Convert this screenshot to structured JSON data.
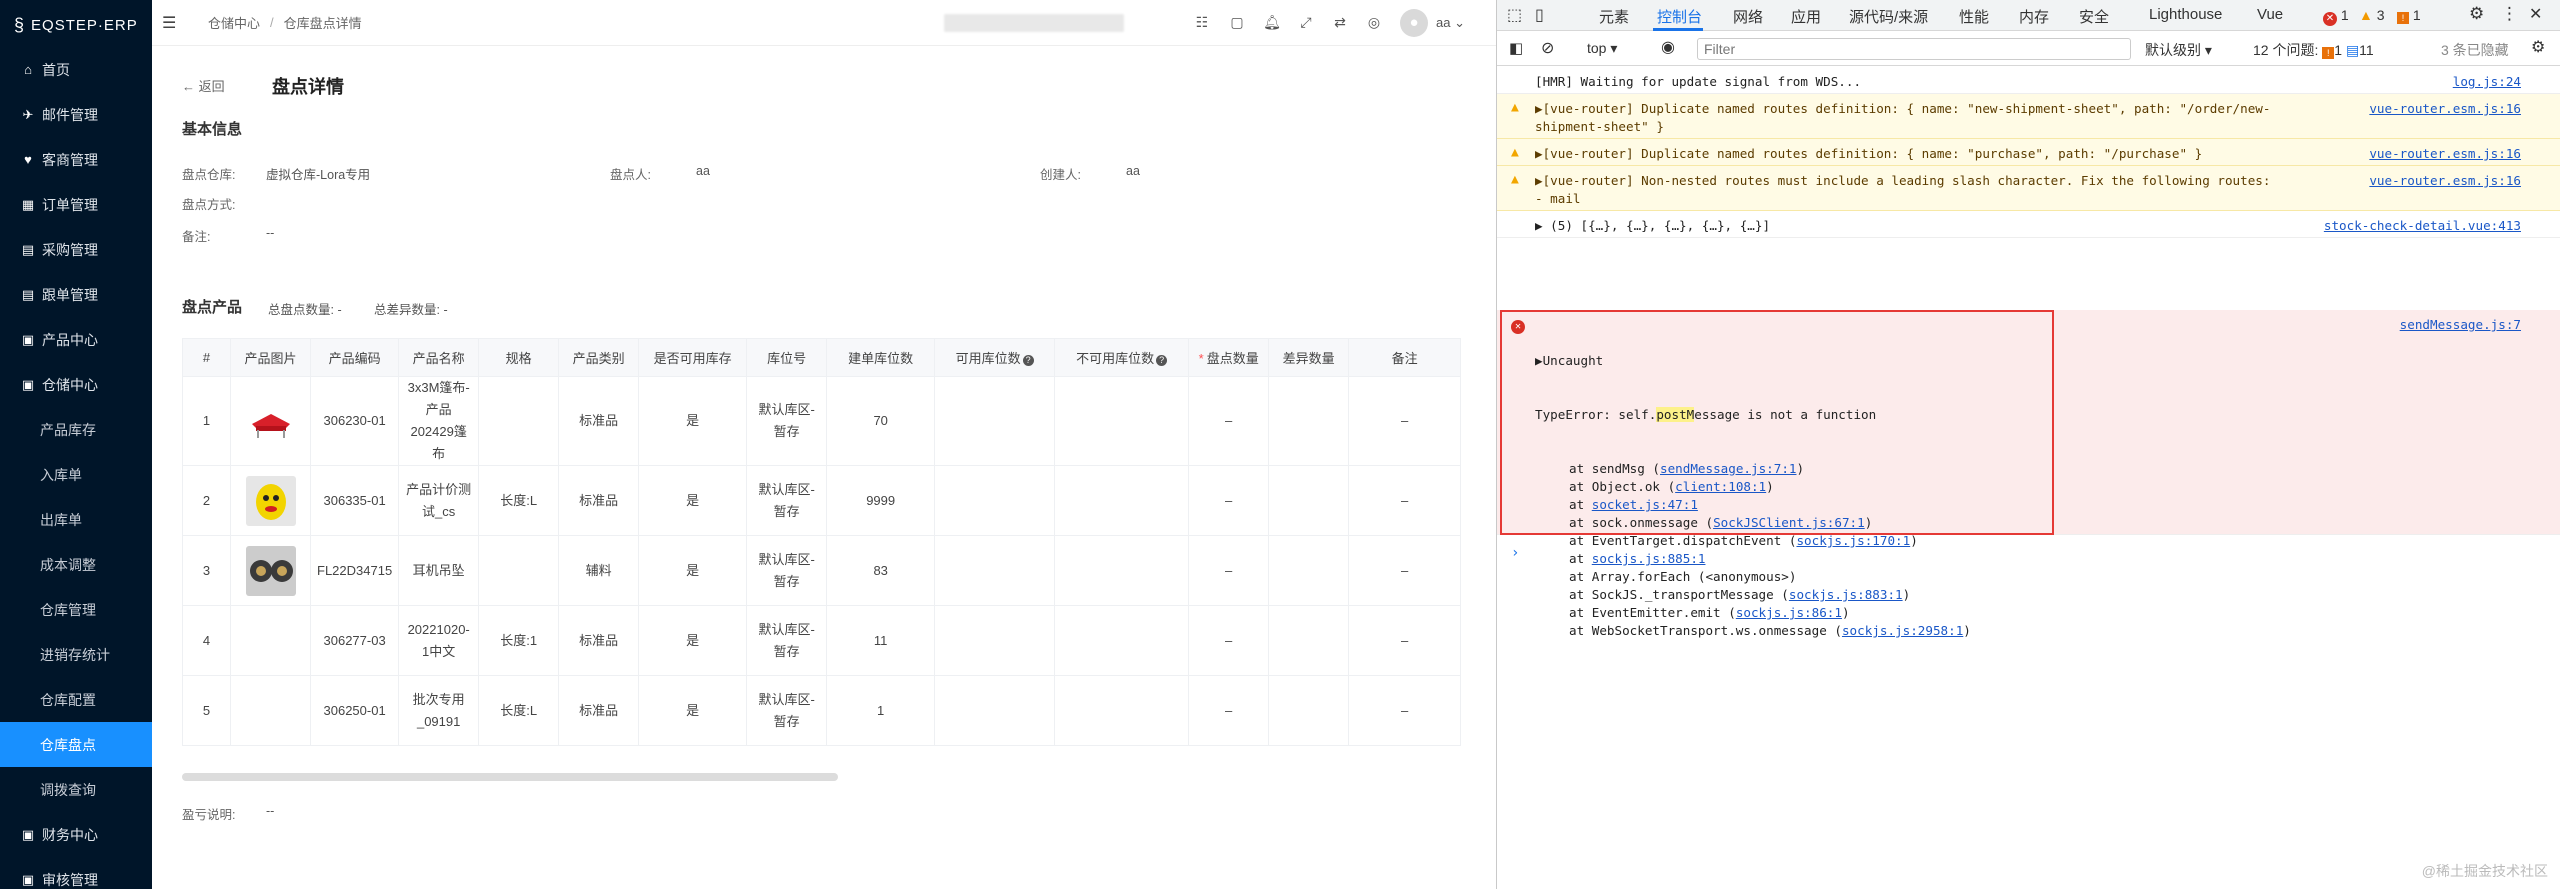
{
  "app": {
    "logo": "EQSTEP·ERP"
  },
  "sidebar": {
    "items": [
      {
        "label": "首页",
        "icon": "home-icon",
        "glyph": "⌂",
        "sub": false,
        "active": false
      },
      {
        "label": "邮件管理",
        "icon": "send-icon",
        "glyph": "✈",
        "sub": false,
        "active": false
      },
      {
        "label": "客商管理",
        "icon": "heart-icon",
        "glyph": "♥",
        "sub": false,
        "active": false
      },
      {
        "label": "订单管理",
        "icon": "grid-icon",
        "glyph": "▦",
        "sub": false,
        "active": false
      },
      {
        "label": "采购管理",
        "icon": "cart-icon",
        "glyph": "▤",
        "sub": false,
        "active": false
      },
      {
        "label": "跟单管理",
        "icon": "track-icon",
        "glyph": "▤",
        "sub": false,
        "active": false
      },
      {
        "label": "产品中心",
        "icon": "box-icon",
        "glyph": "▣",
        "sub": false,
        "active": false
      },
      {
        "label": "仓储中心",
        "icon": "warehouse-icon",
        "glyph": "▣",
        "sub": false,
        "active": false
      },
      {
        "label": "产品库存",
        "sub": true,
        "active": false
      },
      {
        "label": "入库单",
        "sub": true,
        "active": false
      },
      {
        "label": "出库单",
        "sub": true,
        "active": false
      },
      {
        "label": "成本调整",
        "sub": true,
        "active": false
      },
      {
        "label": "仓库管理",
        "sub": true,
        "active": false
      },
      {
        "label": "进销存统计",
        "sub": true,
        "active": false
      },
      {
        "label": "仓库配置",
        "sub": true,
        "active": false
      },
      {
        "label": "仓库盘点",
        "sub": true,
        "active": true
      },
      {
        "label": "调拨查询",
        "sub": true,
        "active": false
      },
      {
        "label": "财务中心",
        "icon": "finance-icon",
        "glyph": "▣",
        "sub": false,
        "active": false
      },
      {
        "label": "审核管理",
        "icon": "audit-icon",
        "glyph": "▣",
        "sub": false,
        "active": false
      }
    ]
  },
  "topbar": {
    "breadcrumb": [
      "仓储中心",
      "仓库盘点详情"
    ],
    "user": "aa"
  },
  "page": {
    "back": "← 返回",
    "title": "盘点详情",
    "basic_title": "基本信息",
    "info": {
      "warehouse_label": "盘点仓库:",
      "warehouse_value": "虚拟仓库-Lora专用",
      "checker_label": "盘点人:",
      "checker_value": "aa",
      "creator_label": "创建人:",
      "creator_value": "aa",
      "method_label": "盘点方式:",
      "method_value": "",
      "remark_label": "备注:",
      "remark_value": "--"
    },
    "products_title": "盘点产品",
    "total_label": "总盘点数量: -",
    "diff_label": "总差异数量: -",
    "loss_label": "盈亏说明:",
    "loss_value": "--"
  },
  "table": {
    "headers": [
      "#",
      "产品图片",
      "产品编码",
      "产品名称",
      "规格",
      "产品类别",
      "是否可用库存",
      "库位号",
      "建单库位数",
      "可用库位数",
      "不可用库位数",
      "盘点数量",
      "差异数量",
      "备注"
    ],
    "rows": [
      {
        "no": "1",
        "img": "tent",
        "code": "306230-01",
        "name": "3x3M篷布-产品202429篷布",
        "spec": "",
        "cat": "标准品",
        "avail": "是",
        "loc": "默认库区-暂存",
        "qty": "70",
        "ok": "",
        "bad": "",
        "count": "–",
        "diff": "",
        "remark": "–"
      },
      {
        "no": "2",
        "img": "ball",
        "code": "306335-01",
        "name": "产品计价测试_cs",
        "spec": "长度:L",
        "cat": "标准品",
        "avail": "是",
        "loc": "默认库区-暂存",
        "qty": "9999",
        "ok": "",
        "bad": "",
        "count": "–",
        "diff": "",
        "remark": "–"
      },
      {
        "no": "3",
        "img": "earring",
        "code": "FL22D34715",
        "name": "耳机吊坠",
        "spec": "",
        "cat": "辅料",
        "avail": "是",
        "loc": "默认库区-暂存",
        "qty": "83",
        "ok": "",
        "bad": "",
        "count": "–",
        "diff": "",
        "remark": "–"
      },
      {
        "no": "4",
        "img": "",
        "code": "306277-03",
        "name": "20221020-1中文",
        "spec": "长度:1",
        "cat": "标准品",
        "avail": "是",
        "loc": "默认库区-暂存",
        "qty": "11",
        "ok": "",
        "bad": "",
        "count": "–",
        "diff": "",
        "remark": "–"
      },
      {
        "no": "5",
        "img": "",
        "code": "306250-01",
        "name": "批次专用_09191",
        "spec": "长度:L",
        "cat": "标准品",
        "avail": "是",
        "loc": "默认库区-暂存",
        "qty": "1",
        "ok": "",
        "bad": "",
        "count": "–",
        "diff": "",
        "remark": "–"
      }
    ]
  },
  "devtools": {
    "tabs": [
      "元素",
      "控制台",
      "网络",
      "应用",
      "源代码/来源",
      "性能",
      "内存",
      "安全",
      "Lighthouse",
      "Vue"
    ],
    "active_tab": "控制台",
    "badges": {
      "errors": "1",
      "warnings": "3",
      "issues": "1"
    },
    "context": "top",
    "filter_placeholder": "Filter",
    "level": "默认级别",
    "issues_label": "12 个问题:",
    "issues_warn": "1",
    "issues_info": "11",
    "hidden": "3 条已隐藏",
    "console": [
      {
        "type": "log",
        "text": "[HMR] Waiting for update signal from WDS...",
        "source": "log.js:24"
      },
      {
        "type": "warn",
        "text": "▶[vue-router] Duplicate named routes definition: { name: \"new-shipment-sheet\", path: \"/order/new-\nshipment-sheet\" }",
        "source": "vue-router.esm.js:16"
      },
      {
        "type": "warn",
        "text": "▶[vue-router] Duplicate named routes definition: { name: \"purchase\", path: \"/purchase\" }",
        "source": "vue-router.esm.js:16"
      },
      {
        "type": "warn",
        "text": "▶[vue-router] Non-nested routes must include a leading slash character. Fix the following routes:\n- mail",
        "source": "vue-router.esm.js:16"
      },
      {
        "type": "log",
        "text": "▶ (5) [{…}, {…}, {…}, {…}, {…}]",
        "source": "stock-check-detail.vue:413"
      }
    ],
    "error": {
      "head": "▶Uncaught",
      "source": "sendMessage.js:7",
      "message_pre": "TypeError: self.",
      "message_hl": "postM",
      "message_post": "essage is not a function",
      "stack": [
        {
          "fn": "at sendMsg (",
          "link": "sendMessage.js:7:1",
          "end": ")"
        },
        {
          "fn": "at Object.ok (",
          "link": "client:108:1",
          "end": ")"
        },
        {
          "fn": "at ",
          "link": "socket.js:47:1",
          "end": ""
        },
        {
          "fn": "at sock.onmessage (",
          "link": "SockJSClient.js:67:1",
          "end": ")"
        },
        {
          "fn": "at EventTarget.dispatchEvent (",
          "link": "sockjs.js:170:1",
          "end": ")"
        },
        {
          "fn": "at ",
          "link": "sockjs.js:885:1",
          "end": ""
        },
        {
          "fn": "at Array.forEach (<anonymous>)",
          "link": "",
          "end": ""
        },
        {
          "fn": "at SockJS._transportMessage (",
          "link": "sockjs.js:883:1",
          "end": ")"
        },
        {
          "fn": "at EventEmitter.emit (",
          "link": "sockjs.js:86:1",
          "end": ")"
        },
        {
          "fn": "at WebSocketTransport.ws.onmessage (",
          "link": "sockjs.js:2958:1",
          "end": ")"
        }
      ]
    },
    "watermark": "@稀土掘金技术社区"
  }
}
